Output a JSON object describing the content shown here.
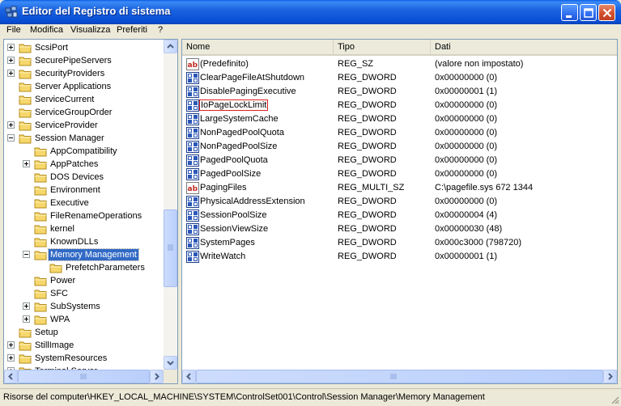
{
  "window": {
    "title": "Editor del Registro di sistema"
  },
  "menu": [
    {
      "label": "File"
    },
    {
      "label": "Modifica"
    },
    {
      "label": "Visualizza"
    },
    {
      "label": "Preferiti"
    },
    {
      "label": "?"
    }
  ],
  "tree": {
    "items": [
      {
        "label": "ScsiPort",
        "expander": "plus",
        "level": 0,
        "selected": false
      },
      {
        "label": "SecurePipeServers",
        "expander": "plus",
        "level": 0,
        "selected": false
      },
      {
        "label": "SecurityProviders",
        "expander": "plus",
        "level": 0,
        "selected": false
      },
      {
        "label": "Server Applications",
        "expander": "none",
        "level": 0,
        "selected": false
      },
      {
        "label": "ServiceCurrent",
        "expander": "none",
        "level": 0,
        "selected": false
      },
      {
        "label": "ServiceGroupOrder",
        "expander": "none",
        "level": 0,
        "selected": false
      },
      {
        "label": "ServiceProvider",
        "expander": "plus",
        "level": 0,
        "selected": false
      },
      {
        "label": "Session Manager",
        "expander": "minus",
        "level": 0,
        "selected": false
      },
      {
        "label": "AppCompatibility",
        "expander": "none",
        "level": 1,
        "selected": false
      },
      {
        "label": "AppPatches",
        "expander": "plus",
        "level": 1,
        "selected": false
      },
      {
        "label": "DOS Devices",
        "expander": "none",
        "level": 1,
        "selected": false
      },
      {
        "label": "Environment",
        "expander": "none",
        "level": 1,
        "selected": false
      },
      {
        "label": "Executive",
        "expander": "none",
        "level": 1,
        "selected": false
      },
      {
        "label": "FileRenameOperations",
        "expander": "none",
        "level": 1,
        "selected": false
      },
      {
        "label": "kernel",
        "expander": "none",
        "level": 1,
        "selected": false
      },
      {
        "label": "KnownDLLs",
        "expander": "none",
        "level": 1,
        "selected": false
      },
      {
        "label": "Memory Management",
        "expander": "minus",
        "level": 1,
        "selected": true
      },
      {
        "label": "PrefetchParameters",
        "expander": "none",
        "level": 2,
        "selected": false
      },
      {
        "label": "Power",
        "expander": "none",
        "level": 1,
        "selected": false
      },
      {
        "label": "SFC",
        "expander": "none",
        "level": 1,
        "selected": false
      },
      {
        "label": "SubSystems",
        "expander": "plus",
        "level": 1,
        "selected": false
      },
      {
        "label": "WPA",
        "expander": "plus",
        "level": 1,
        "selected": false
      },
      {
        "label": "Setup",
        "expander": "none",
        "level": 0,
        "selected": false
      },
      {
        "label": "StillImage",
        "expander": "plus",
        "level": 0,
        "selected": false
      },
      {
        "label": "SystemResources",
        "expander": "plus",
        "level": 0,
        "selected": false
      },
      {
        "label": "Terminal Server",
        "expander": "plus",
        "level": 0,
        "selected": false
      }
    ]
  },
  "list": {
    "columns": [
      {
        "label": "Nome"
      },
      {
        "label": "Tipo"
      },
      {
        "label": "Dati"
      }
    ],
    "rows": [
      {
        "name": "(Predefinito)",
        "type": "REG_SZ",
        "data": "(valore non impostato)",
        "icon": "string-value-icon"
      },
      {
        "name": "ClearPageFileAtShutdown",
        "type": "REG_DWORD",
        "data": "0x00000000 (0)",
        "icon": "binary-value-icon"
      },
      {
        "name": "DisablePagingExecutive",
        "type": "REG_DWORD",
        "data": "0x00000001 (1)",
        "icon": "binary-value-icon"
      },
      {
        "name": "IoPageLockLimit",
        "type": "REG_DWORD",
        "data": "0x00000000 (0)",
        "icon": "binary-value-icon",
        "editing": true
      },
      {
        "name": "LargeSystemCache",
        "type": "REG_DWORD",
        "data": "0x00000000 (0)",
        "icon": "binary-value-icon"
      },
      {
        "name": "NonPagedPoolQuota",
        "type": "REG_DWORD",
        "data": "0x00000000 (0)",
        "icon": "binary-value-icon"
      },
      {
        "name": "NonPagedPoolSize",
        "type": "REG_DWORD",
        "data": "0x00000000 (0)",
        "icon": "binary-value-icon"
      },
      {
        "name": "PagedPoolQuota",
        "type": "REG_DWORD",
        "data": "0x00000000 (0)",
        "icon": "binary-value-icon"
      },
      {
        "name": "PagedPoolSize",
        "type": "REG_DWORD",
        "data": "0x00000000 (0)",
        "icon": "binary-value-icon"
      },
      {
        "name": "PagingFiles",
        "type": "REG_MULTI_SZ",
        "data": "C:\\pagefile.sys 672 1344",
        "icon": "string-value-icon"
      },
      {
        "name": "PhysicalAddressExtension",
        "type": "REG_DWORD",
        "data": "0x00000000 (0)",
        "icon": "binary-value-icon"
      },
      {
        "name": "SessionPoolSize",
        "type": "REG_DWORD",
        "data": "0x00000004 (4)",
        "icon": "binary-value-icon"
      },
      {
        "name": "SessionViewSize",
        "type": "REG_DWORD",
        "data": "0x00000030 (48)",
        "icon": "binary-value-icon"
      },
      {
        "name": "SystemPages",
        "type": "REG_DWORD",
        "data": "0x000c3000 (798720)",
        "icon": "binary-value-icon"
      },
      {
        "name": "WriteWatch",
        "type": "REG_DWORD",
        "data": "0x00000001 (1)",
        "icon": "binary-value-icon"
      }
    ]
  },
  "status": {
    "path": "Risorse del computer\\HKEY_LOCAL_MACHINE\\SYSTEM\\ControlSet001\\Control\\Session Manager\\Memory Management"
  },
  "colors": {
    "titlebar": "#0a4fd6",
    "selection": "#316ac5",
    "edit_border": "#e02020",
    "folder": "#f6d76b"
  }
}
